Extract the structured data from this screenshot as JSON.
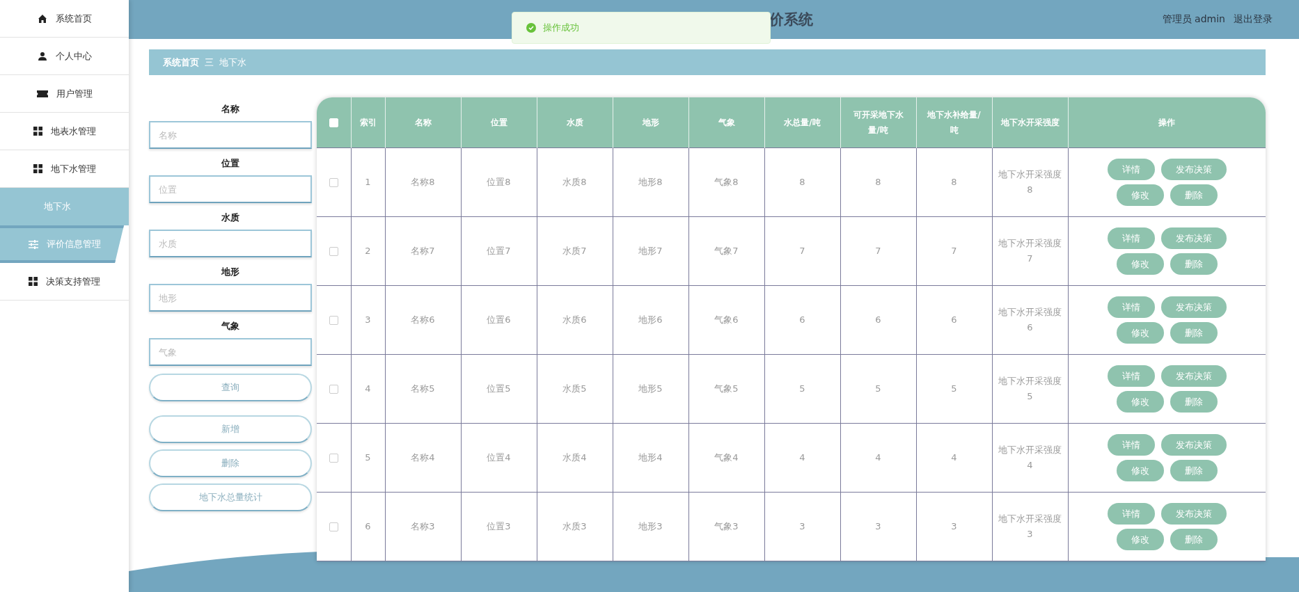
{
  "header": {
    "title": "价系统",
    "user_role": "管理员",
    "user_name": "admin",
    "logout": "退出登录"
  },
  "toast": {
    "kind": "success",
    "message": "操作成功"
  },
  "sidebar": {
    "items": [
      {
        "label": "系统首页",
        "hovered": false
      },
      {
        "label": "个人中心",
        "hovered": false
      },
      {
        "label": "用户管理",
        "hovered": false
      },
      {
        "label": "地表水管理",
        "hovered": false
      },
      {
        "label": "地下水管理",
        "hovered": false,
        "expanded": true,
        "children": [
          {
            "label": "地下水",
            "selected": true
          }
        ]
      },
      {
        "label": "评价信息管理",
        "hovered": true
      },
      {
        "label": "决策支持管理",
        "hovered": false
      }
    ]
  },
  "breadcrumb": {
    "items": [
      "系统首页",
      "地下水"
    ],
    "separator": "三"
  },
  "search": {
    "fields": [
      {
        "label": "名称",
        "placeholder": "名称"
      },
      {
        "label": "位置",
        "placeholder": "位置"
      },
      {
        "label": "水质",
        "placeholder": "水质"
      },
      {
        "label": "地形",
        "placeholder": "地形"
      },
      {
        "label": "气象",
        "placeholder": "气象"
      }
    ],
    "buttons": [
      {
        "label": "查询",
        "kind": "query"
      },
      {
        "label": "新增",
        "kind": "action"
      },
      {
        "label": "删除",
        "kind": "action"
      },
      {
        "label": "地下水总量统计",
        "kind": "action"
      }
    ]
  },
  "table": {
    "select_all": {
      "checked": false
    },
    "columns": [
      "索引",
      "名称",
      "位置",
      "水质",
      "地形",
      "气象",
      "水总量/吨",
      "可开采地下水量/吨",
      "地下水补给量/吨",
      "地下水开采强度",
      "操作"
    ],
    "rows": [
      {
        "checked": false,
        "cells": [
          "1",
          "名称8",
          "位置8",
          "水质8",
          "地形8",
          "气象8",
          "8",
          "8",
          "8",
          "地下水开采强度8"
        ],
        "actions": [
          "详情",
          "发布决策",
          "修改",
          "删除"
        ]
      },
      {
        "checked": false,
        "cells": [
          "2",
          "名称7",
          "位置7",
          "水质7",
          "地形7",
          "气象7",
          "7",
          "7",
          "7",
          "地下水开采强度7"
        ],
        "actions": [
          "详情",
          "发布决策",
          "修改",
          "删除"
        ]
      },
      {
        "checked": false,
        "cells": [
          "3",
          "名称6",
          "位置6",
          "水质6",
          "地形6",
          "气象6",
          "6",
          "6",
          "6",
          "地下水开采强度6"
        ],
        "actions": [
          "详情",
          "发布决策",
          "修改",
          "删除"
        ]
      },
      {
        "checked": false,
        "cells": [
          "4",
          "名称5",
          "位置5",
          "水质5",
          "地形5",
          "气象5",
          "5",
          "5",
          "5",
          "地下水开采强度5"
        ],
        "actions": [
          "详情",
          "发布决策",
          "修改",
          "删除"
        ]
      },
      {
        "checked": false,
        "cells": [
          "5",
          "名称4",
          "位置4",
          "水质4",
          "地形4",
          "气象4",
          "4",
          "4",
          "4",
          "地下水开采强度4"
        ],
        "actions": [
          "详情",
          "发布决策",
          "修改",
          "删除"
        ]
      },
      {
        "checked": false,
        "cells": [
          "6",
          "名称3",
          "位置3",
          "水质3",
          "地形3",
          "气象3",
          "3",
          "3",
          "3",
          "地下水开采强度3"
        ],
        "actions": [
          "详情",
          "发布决策",
          "修改",
          "删除"
        ]
      }
    ]
  }
}
